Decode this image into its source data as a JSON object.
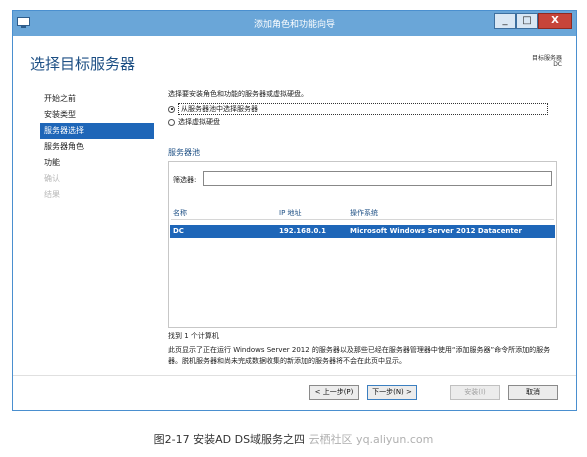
{
  "window": {
    "title": "添加角色和功能向导",
    "controls": {
      "minimize": "_",
      "maximize": "□",
      "close": "X"
    }
  },
  "header": {
    "page_title": "选择目标服务器",
    "destination_label": "目标服务器",
    "destination_value": "DC"
  },
  "nav": {
    "items": [
      {
        "label": "开始之前",
        "state": "normal"
      },
      {
        "label": "安装类型",
        "state": "normal"
      },
      {
        "label": "服务器选择",
        "state": "active"
      },
      {
        "label": "服务器角色",
        "state": "normal"
      },
      {
        "label": "功能",
        "state": "normal"
      },
      {
        "label": "确认",
        "state": "disabled"
      },
      {
        "label": "结果",
        "state": "disabled"
      }
    ]
  },
  "content": {
    "instruction": "选择要安装角色和功能的服务器或虚拟硬盘。",
    "radio_pool": "从服务器池中选择服务器",
    "radio_vhd": "选择虚拟硬盘",
    "pool_title": "服务器池",
    "filter_label": "筛选器:",
    "filter_value": "",
    "columns": [
      "名称",
      "IP 地址",
      "操作系统"
    ],
    "rows": [
      {
        "name": "DC",
        "ip": "192.168.0.1",
        "os": "Microsoft Windows Server 2012 Datacenter"
      }
    ],
    "found_text": "找到 1 个计算机",
    "note": "此页显示了正在运行 Windows Server 2012 的服务器以及那些已经在服务器管理器中使用“添加服务器”命令所添加的服务器。脱机服务器和尚未完成数据收集的新添加的服务器将不会在此页中显示。"
  },
  "buttons": {
    "prev": "< 上一步(P)",
    "next": "下一步(N) >",
    "install": "安装(I)",
    "cancel": "取消"
  },
  "caption": {
    "text": "图2-17 安装AD DS域服务之四",
    "watermark": "云栖社区 yq.aliyun.com"
  },
  "colors": {
    "titlebar": "#6aa6d8",
    "selection": "#1e66b8",
    "heading": "#1d4f84"
  }
}
